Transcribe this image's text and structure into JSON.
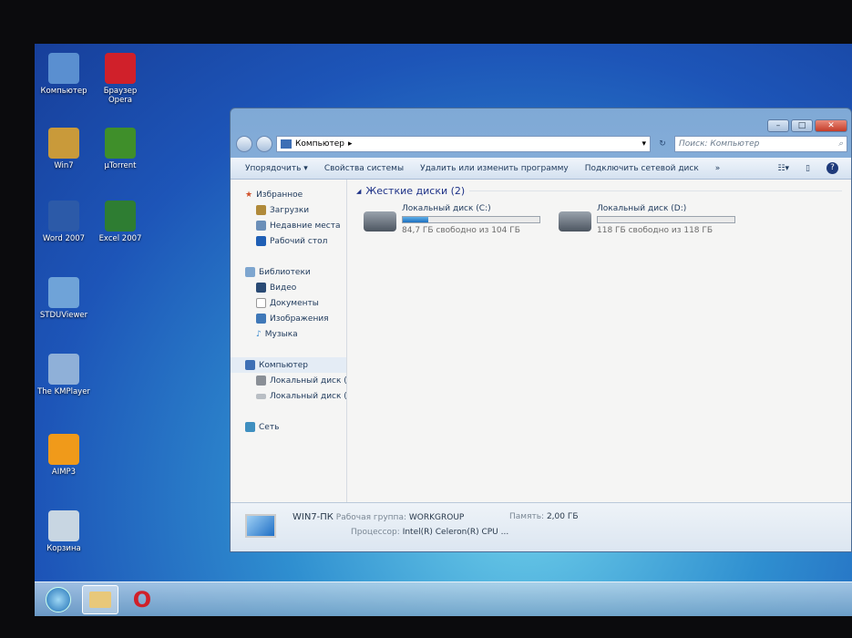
{
  "desktop_icons": [
    {
      "label": "Компьютер",
      "icon": "computer-icon",
      "color": "#5a8fd0"
    },
    {
      "label": "Браузер Opera",
      "icon": "opera-icon",
      "color": "#d0202a"
    },
    {
      "label": "Win7",
      "icon": "folder-icon",
      "color": "#c99a3a"
    },
    {
      "label": "µTorrent",
      "icon": "utorrent-icon",
      "color": "#3f8f2a"
    },
    {
      "label": "Word 2007",
      "icon": "word-icon",
      "color": "#2c5aa8"
    },
    {
      "label": "Excel 2007",
      "icon": "excel-icon",
      "color": "#2e7d32"
    },
    {
      "label": "STDUViewer",
      "icon": "stduviewer-icon",
      "color": "#6fa3d8"
    },
    {
      "label": "The KMPlayer",
      "icon": "kmplayer-icon",
      "color": "#8fb0d8"
    },
    {
      "label": "AIMP3",
      "icon": "aimp-icon",
      "color": "#f09a1a"
    },
    {
      "label": "Корзина",
      "icon": "recycle-bin-icon",
      "color": "#c8d6e2"
    }
  ],
  "window": {
    "breadcrumb": "Компьютер",
    "search_placeholder": "Поиск: Компьютер",
    "toolbar": [
      "Упорядочить ▾",
      "Свойства системы",
      "Удалить или изменить программу",
      "Подключить сетевой диск",
      "»"
    ],
    "nav": {
      "favorites": "Избранное",
      "fav_items": [
        "Загрузки",
        "Недавние места",
        "Рабочий стол"
      ],
      "libraries": "Библиотеки",
      "lib_items": [
        "Видео",
        "Документы",
        "Изображения",
        "Музыка"
      ],
      "computer": "Компьютер",
      "comp_items": [
        "Локальный диск (C",
        "Локальный диск (D"
      ],
      "network": "Сеть"
    },
    "group": "Жесткие диски (2)",
    "drives": [
      {
        "name": "Локальный диск (C:)",
        "free": "84,7 ГБ свободно из 104 ГБ",
        "used_percent": 18.6
      },
      {
        "name": "Локальный диск (D:)",
        "free": "118 ГБ свободно из 118 ГБ",
        "used_percent": 0
      }
    ],
    "details": {
      "pc": "WIN7-ПК",
      "workgroup_label": "Рабочая группа:",
      "workgroup": "WORKGROUP",
      "memory_label": "Память:",
      "memory": "2,00 ГБ",
      "cpu_label": "Процессор:",
      "cpu": "Intel(R) Celeron(R) CPU ..."
    }
  }
}
